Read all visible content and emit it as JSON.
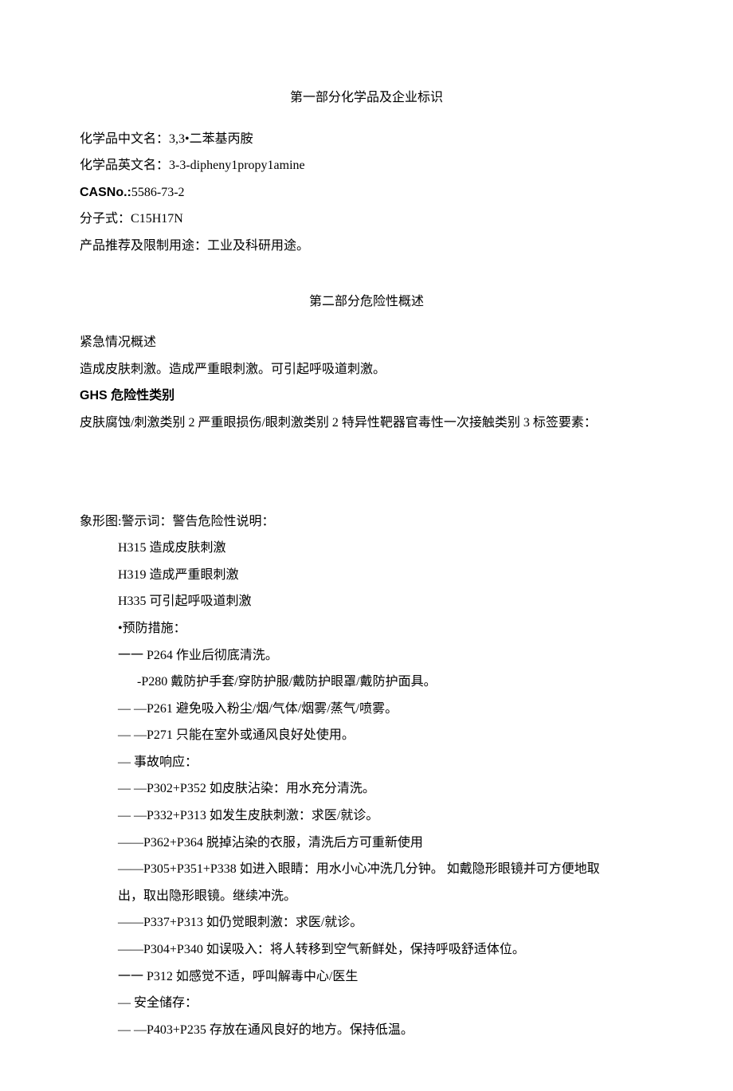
{
  "section1": {
    "title": "第一部分化学品及企业标识",
    "name_cn_label": "化学品中文名：",
    "name_cn_value": "3,3•二苯基丙胺",
    "name_en_label": "化学品英文名：",
    "name_en_value": "3-3-dipheny1propy1amine",
    "cas_label": "CASNo.:",
    "cas_value": "5586-73-2",
    "formula_label": "分子式：",
    "formula_value": "C15H17N",
    "use_label": "产品推荐及限制用途：",
    "use_value": "工业及科研用途。"
  },
  "section2": {
    "title": "第二部分危险性概述",
    "emergency_heading": "紧急情况概述",
    "emergency_text": "造成皮肤刺激。造成严重眼刺激。可引起呼吸道刺激。",
    "ghs_heading": "GHS 危险性类别",
    "ghs_text": "皮肤腐蚀/刺激类别 2 严重眼损伤/眼刺激类别 2 特异性靶器官毒性一次接触类别 3 标签要素：",
    "pictogram_line": "象形图:警示词：警告危险性说明：",
    "hazards": [
      "H315 造成皮肤刺激",
      "H319 造成严重眼刺激",
      "H335 可引起呼吸道刺激"
    ],
    "precaution_heading": "•预防措施：",
    "p264": "一一 P264 作业后彻底清洗。",
    "p280": "-P280 戴防护手套/穿防护服/戴防护眼罩/戴防护面具。",
    "p261": "—   —P261 避免吸入粉尘/烟/气体/烟雾/蒸气/喷雾。",
    "p271": "—   —P271 只能在室外或通风良好处使用。",
    "response_heading": "— 事故响应：",
    "p302": "—   —P302+P352 如皮肤沾染：用水充分清洗。",
    "p332": "—   —P332+P313 如发生皮肤刺激：求医/就诊。",
    "p362": "——P362+P364 脱掉沾染的衣服，清洗后方可重新使用",
    "p305": "——P305+P351+P338 如进入眼睛：用水小心冲洗几分钟。      如戴隐形眼镜并可方便地取",
    "p305b": "出，取出隐形眼镜。继续冲洗。",
    "p337": "——P337+P313 如仍觉眼刺激：求医/就诊。",
    "p304": "——P304+P340 如误吸入：将人转移到空气新鲜处，保持呼吸舒适体位。",
    "p312": "一一 P312 如感觉不适，呼叫解毒中心/医生",
    "storage_heading": "— 安全储存：",
    "p403": "—             —P403+P235 存放在通风良好的地方。保持低温。"
  }
}
